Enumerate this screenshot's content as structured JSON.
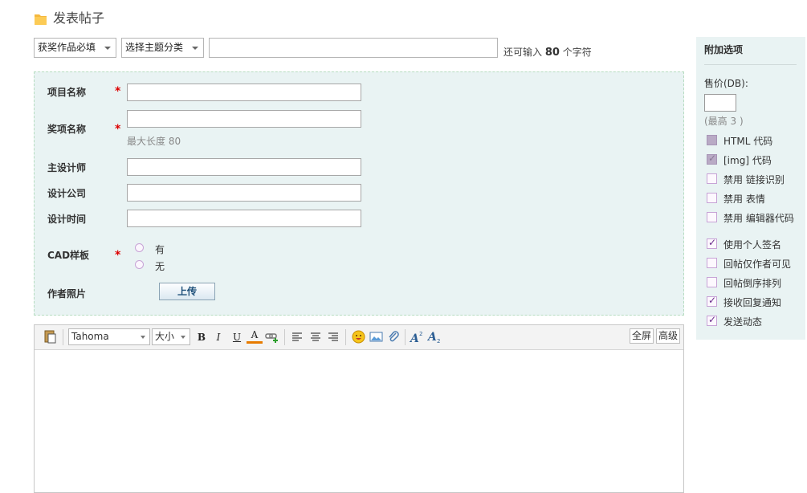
{
  "header": {
    "title": "发表帖子"
  },
  "top": {
    "select_award": "获奖作品必填",
    "select_topic": "选择主题分类",
    "subject_value": "",
    "remain_prefix": "还可输入",
    "remain_count": "80",
    "remain_suffix": "个字符"
  },
  "fields": {
    "project_name": "项目名称",
    "award_name": "奖项名称",
    "max_length_hint": "最大长度 80",
    "designer": "主设计师",
    "company": "设计公司",
    "design_time": "设计时间",
    "cad": "CAD样板",
    "cad_yes": "有",
    "cad_no": "无",
    "photo": "作者照片",
    "upload": "上传",
    "required_mark": "*"
  },
  "editor": {
    "font": "Tahoma",
    "size": "大小",
    "bold": "B",
    "italic": "I",
    "underline": "U",
    "fontcolor": "A",
    "fullscreen": "全屏",
    "advanced": "高级"
  },
  "sidebar": {
    "title": "附加选项",
    "price_label": "售价(DB):",
    "price_value": "",
    "price_note": "(最高 3 )",
    "options": [
      {
        "label": "HTML 代码",
        "checked": false,
        "disabled": true
      },
      {
        "label": "[img] 代码",
        "checked": true,
        "disabled": true
      },
      {
        "label": "禁用  链接识别",
        "checked": false,
        "disabled": false
      },
      {
        "label": "禁用  表情",
        "checked": false,
        "disabled": false
      },
      {
        "label": "禁用  编辑器代码",
        "checked": false,
        "disabled": false
      },
      {
        "label": "使用个人签名",
        "checked": true,
        "disabled": false
      },
      {
        "label": "回帖仅作者可见",
        "checked": false,
        "disabled": false
      },
      {
        "label": "回帖倒序排列",
        "checked": false,
        "disabled": false
      },
      {
        "label": "接收回复通知",
        "checked": true,
        "disabled": false
      },
      {
        "label": "发送动态",
        "checked": true,
        "disabled": false
      }
    ]
  },
  "colors": {
    "panel": "#e9f3f3",
    "required": "#dd0000",
    "checkbox_border": "#c7a3d6"
  }
}
